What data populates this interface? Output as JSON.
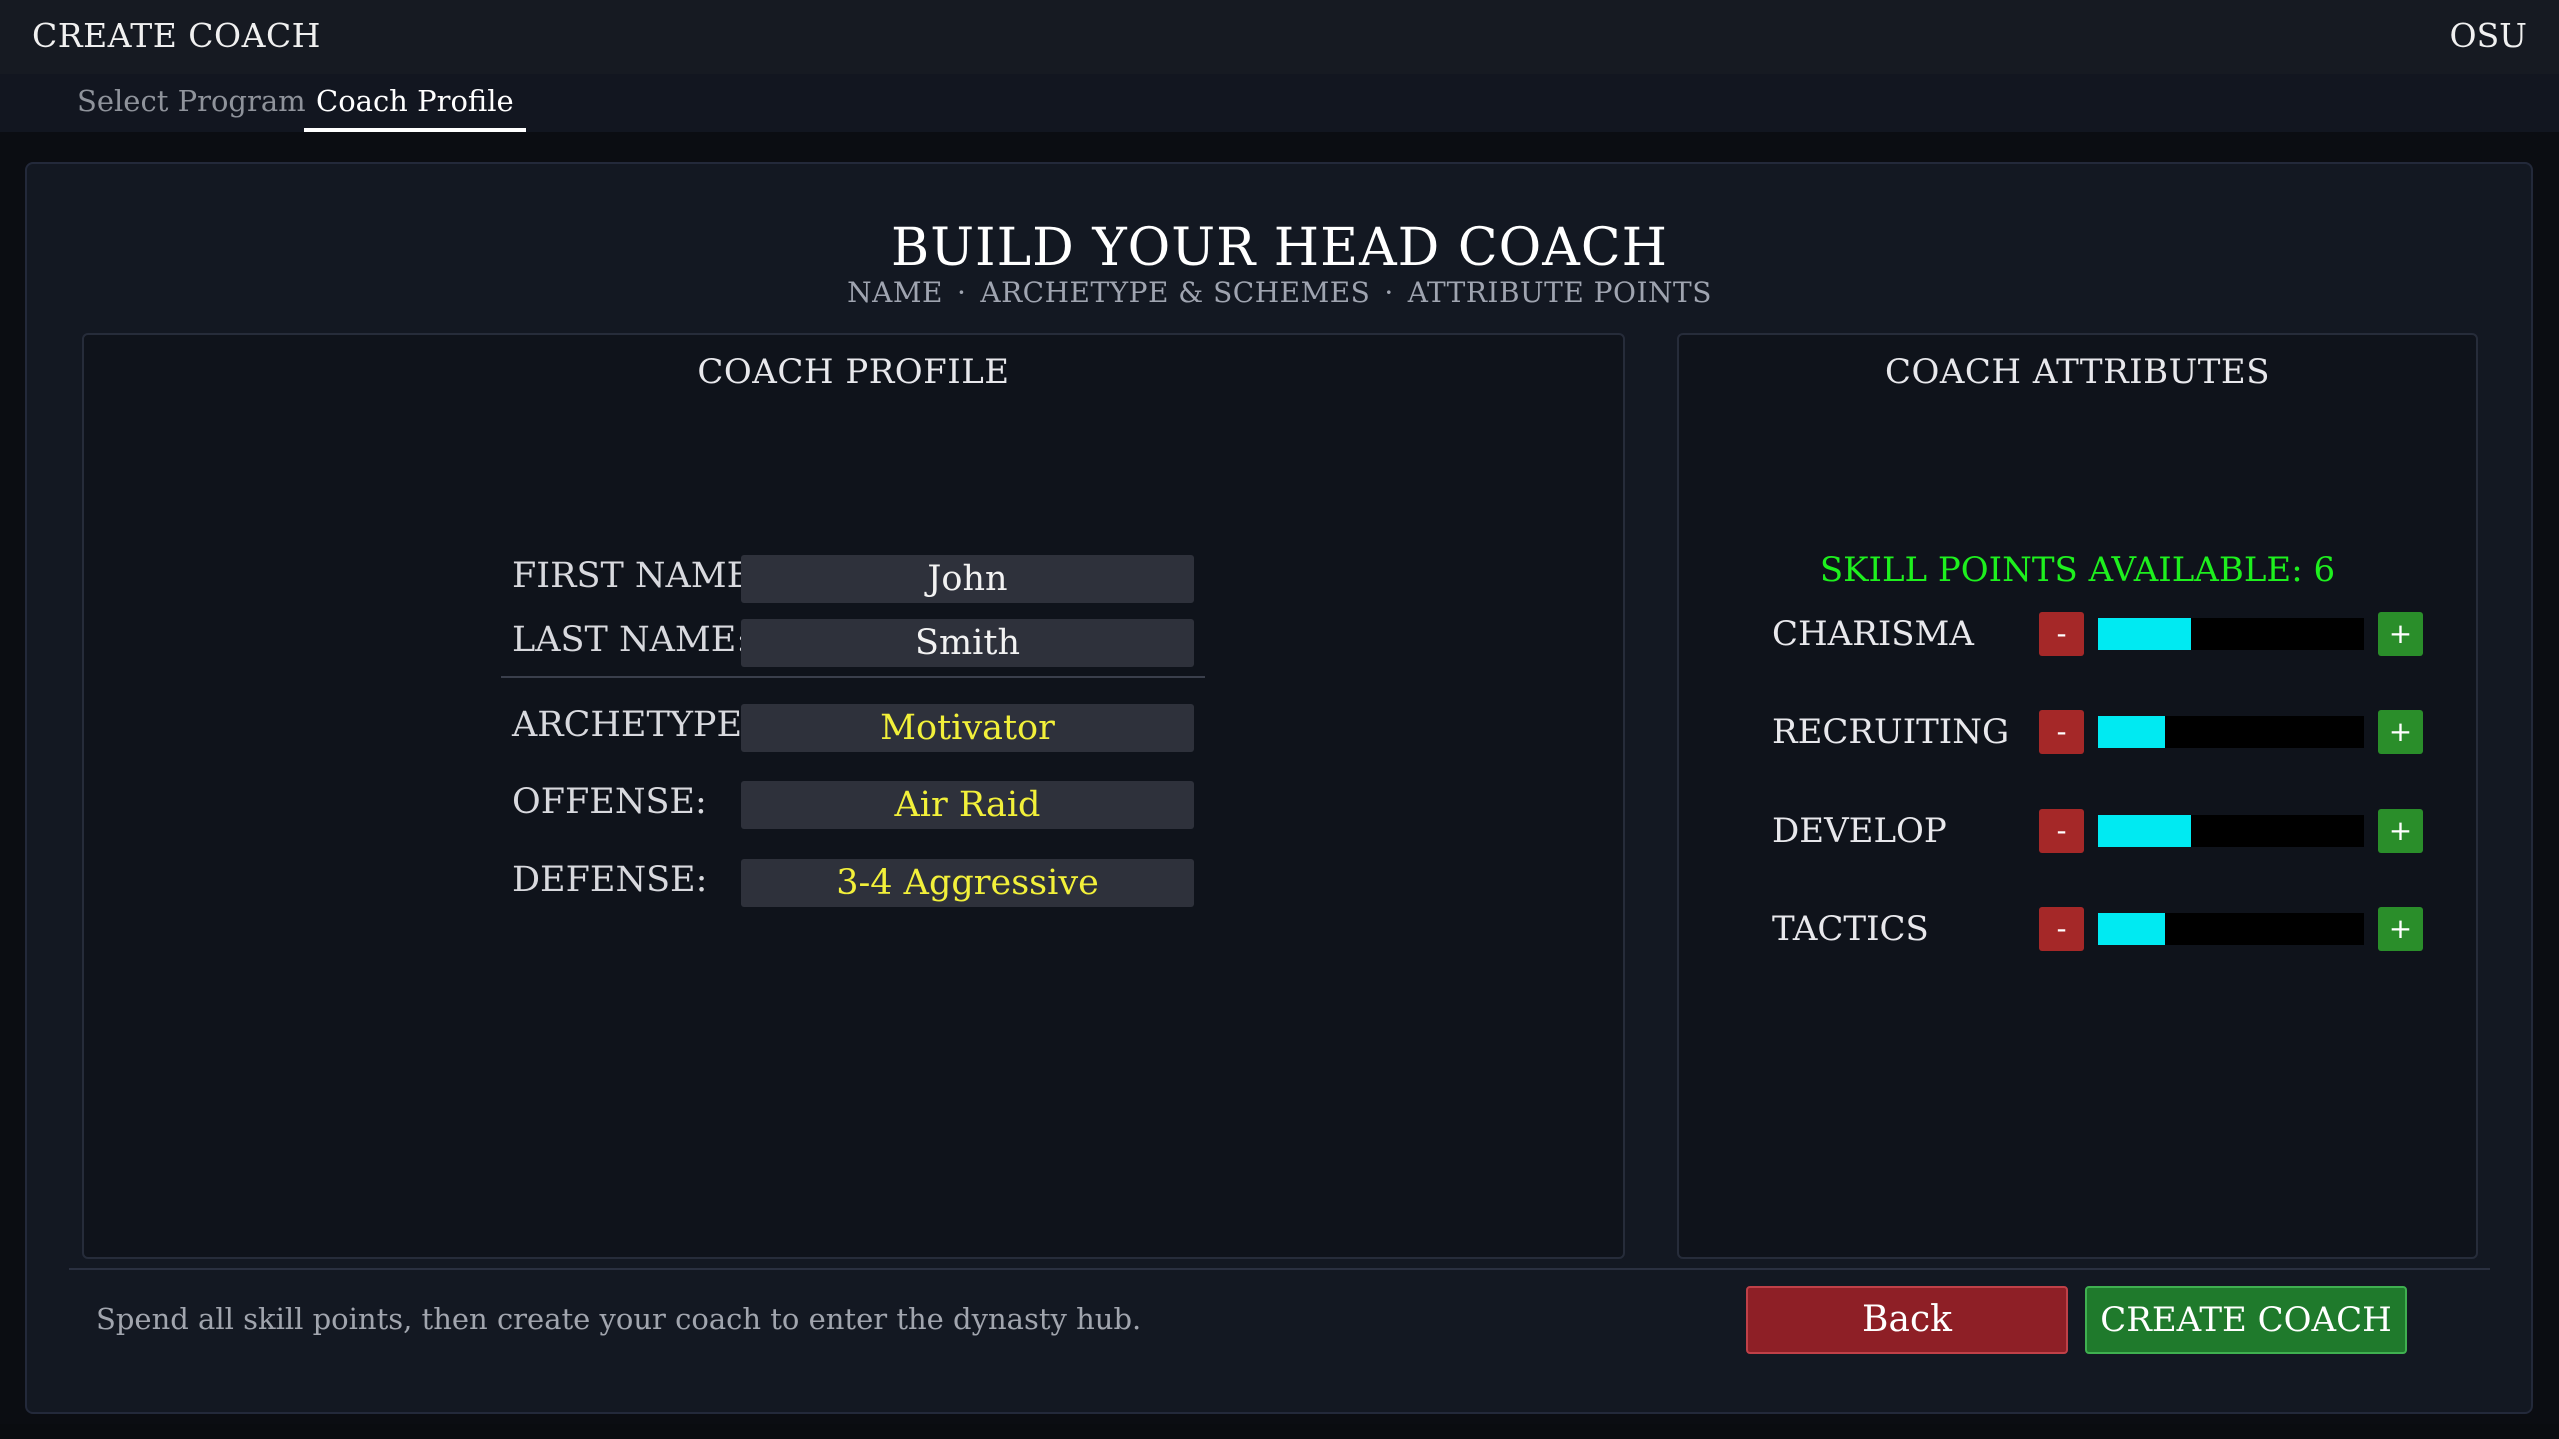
{
  "header": {
    "title": "CREATE COACH",
    "team": "OSU"
  },
  "tabs": [
    {
      "label": "Select Program",
      "active": false
    },
    {
      "label": "Coach Profile",
      "active": true
    }
  ],
  "page": {
    "title": "BUILD YOUR HEAD COACH",
    "steps": [
      "NAME",
      "ARCHETYPE & SCHEMES",
      "ATTRIBUTE POINTS"
    ],
    "separator": "·"
  },
  "profile": {
    "title": "COACH PROFILE",
    "fields": [
      {
        "label": "FIRST NAME:",
        "value": "John"
      },
      {
        "label": "LAST NAME:",
        "value": "Smith"
      },
      {
        "label": "ARCHETYPE:",
        "value": "Motivator"
      },
      {
        "label": "OFFENSE:",
        "value": "Air Raid"
      },
      {
        "label": "DEFENSE:",
        "value": "3-4 Aggressive"
      }
    ]
  },
  "attributes": {
    "title": "COACH ATTRIBUTES",
    "skill_points_text": "SKILL POINTS AVAILABLE: 6",
    "minus_label": "-",
    "plus_label": "+",
    "items": [
      {
        "label": "CHARISMA",
        "level": 0.35
      },
      {
        "label": "RECRUITING",
        "level": 0.25
      },
      {
        "label": "DEVELOP",
        "level": 0.35
      },
      {
        "label": "TACTICS",
        "level": 0.25
      }
    ],
    "bar_color": "#00eaf2"
  },
  "footer": {
    "hint": "Spend all skill points, then create your coach to enter the dynasty hub.",
    "back_label": "Back",
    "create_label": "CREATE COACH"
  }
}
